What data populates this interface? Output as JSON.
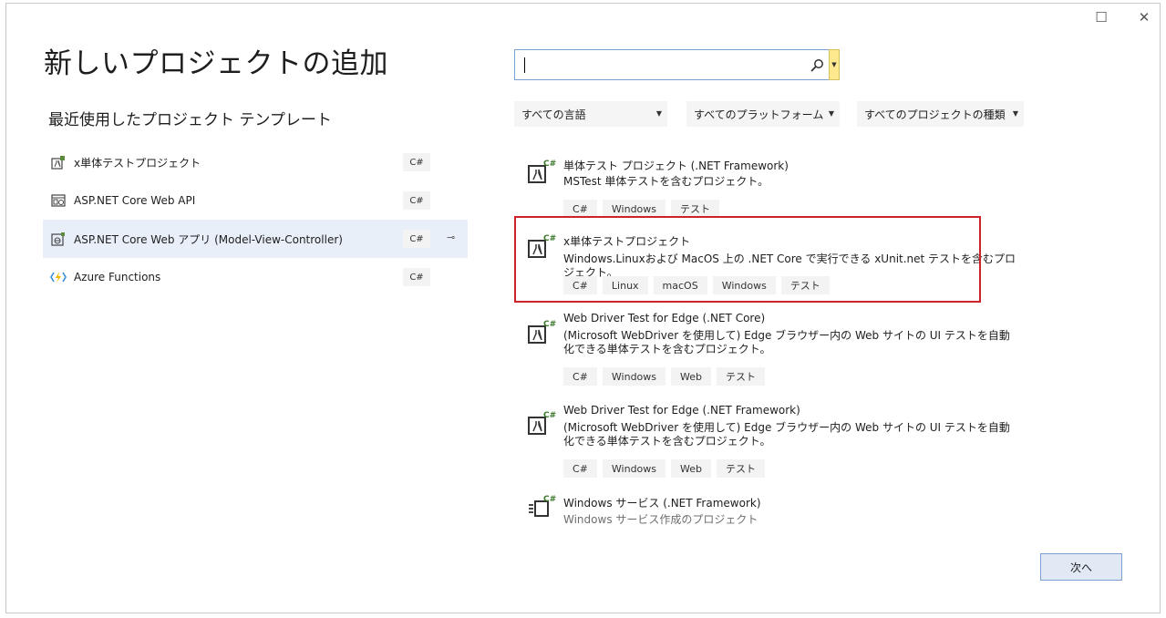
{
  "window": {
    "maximize_glyph": "☐",
    "close_glyph": "✕"
  },
  "title": "新しいプロジェクトの追加",
  "recent": {
    "heading": "最近使用したプロジェクト テンプレート",
    "items": [
      {
        "label": "x単体テストプロジェクト",
        "lang": "C#",
        "icon": "test-project-icon"
      },
      {
        "label": "ASP.NET Core Web API",
        "lang": "C#",
        "icon": "web-api-icon"
      },
      {
        "label": "ASP.NET Core Web アプリ (Model-View-Controller)",
        "lang": "C#",
        "icon": "web-app-icon",
        "pin": "⊸"
      },
      {
        "label": "Azure Functions",
        "lang": "C#",
        "icon": "azure-functions-icon"
      }
    ]
  },
  "search": {
    "value": "",
    "placeholder": ""
  },
  "filters": {
    "language": "すべての言語",
    "platform": "すべてのプラットフォーム",
    "project_type": "すべてのプロジェクトの種類"
  },
  "templates": [
    {
      "name": "単体テスト プロジェクト (.NET Framework)",
      "desc": "MSTest 単体テストを含むプロジェクト。",
      "tags": [
        "C#",
        "Windows",
        "テスト"
      ]
    },
    {
      "name": "x単体テストプロジェクト",
      "desc": "Windows.Linuxおよび MacOS 上の .NET Core で実行できる xUnit.net テストを含むプロジェクト。",
      "tags": [
        "C#",
        "Linux",
        "macOS",
        "Windows",
        "テスト"
      ]
    },
    {
      "name": "Web Driver Test for Edge (.NET Core)",
      "desc": "(Microsoft WebDriver を使用して) Edge ブラウザー内の Web サイトの UI テストを自動化できる単体テストを含むプロジェクト。",
      "tags": [
        "C#",
        "Windows",
        "Web",
        "テスト"
      ]
    },
    {
      "name": "Web Driver Test for Edge (.NET Framework)",
      "desc": "(Microsoft WebDriver を使用して) Edge ブラウザー内の Web サイトの UI テストを自動化できる単体テストを含むプロジェクト。",
      "tags": [
        "C#",
        "Windows",
        "Web",
        "テスト"
      ]
    },
    {
      "name": "Windows サービス (.NET Framework)",
      "desc": "Windows サービス作成のプロジェクト"
    }
  ],
  "icon_badge": "C#",
  "next_button": "次へ",
  "colors": {
    "accent": "#7a9fd1",
    "highlight": "#d0212b",
    "selected_row": "#e8eff9",
    "search_dropdown": "#ffe98f"
  }
}
